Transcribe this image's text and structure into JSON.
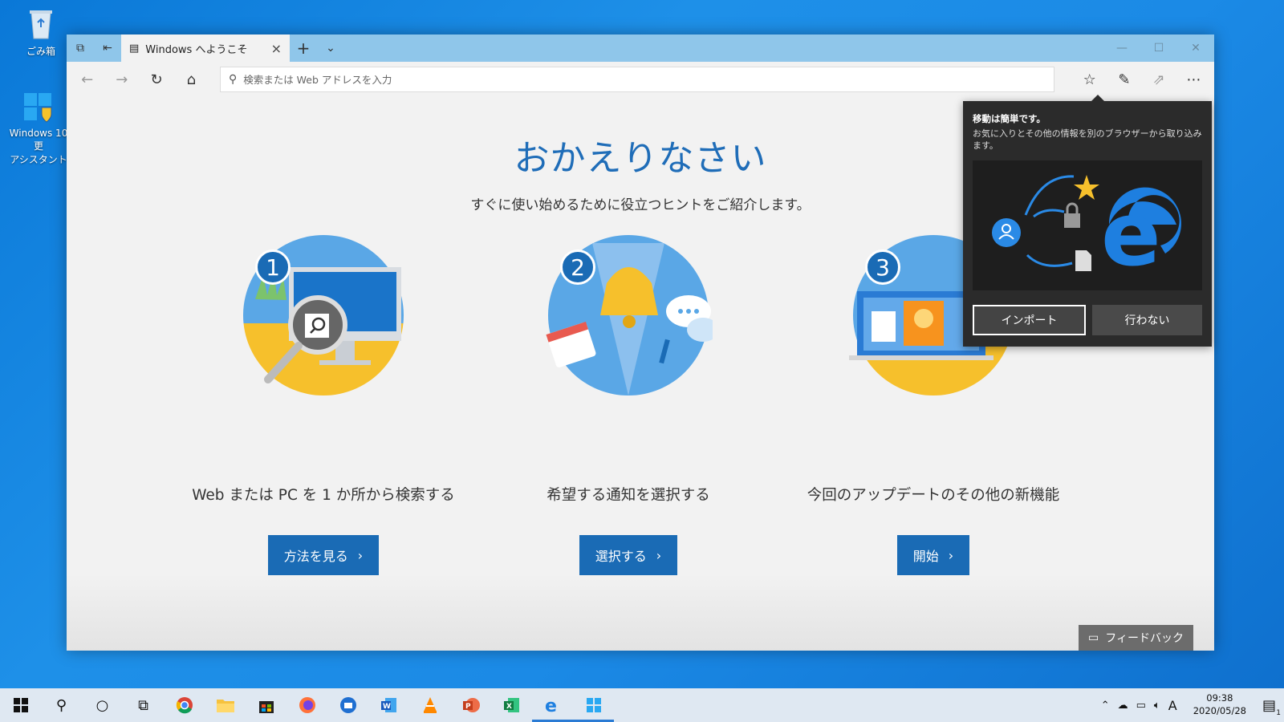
{
  "desktop": {
    "recycle_bin": "ごみ箱",
    "assistant_line1": "Windows 10 更",
    "assistant_line2": "アシスタント"
  },
  "browser": {
    "tab_title": "Windows へようこそ",
    "address_placeholder": "検索または Web アドレスを入力"
  },
  "page": {
    "heading": "おかえりなさい",
    "subheading": "すぐに使い始めるために役立つヒントをご紹介します。",
    "cards": [
      {
        "number": "1",
        "caption": "Web または PC を 1 か所から検索する",
        "button": "方法を見る"
      },
      {
        "number": "2",
        "caption": "希望する通知を選択する",
        "button": "選択する"
      },
      {
        "number": "3",
        "caption": "今回のアップデートのその他の新機能",
        "button": "開始"
      }
    ],
    "feedback": "フィードバック"
  },
  "popup": {
    "title": "移動は簡単です。",
    "description": "お気に入りとその他の情報を別のブラウザーから取り込みます。",
    "import_button": "インポート",
    "skip_button": "行わない"
  },
  "taskbar": {
    "ime": "A",
    "time": "09:38",
    "date": "2020/05/28",
    "notification_count": "1"
  },
  "colors": {
    "accent": "#1a6bb5",
    "title_bar": "#8fc6ea",
    "popup_bg": "#2b2b2b"
  }
}
